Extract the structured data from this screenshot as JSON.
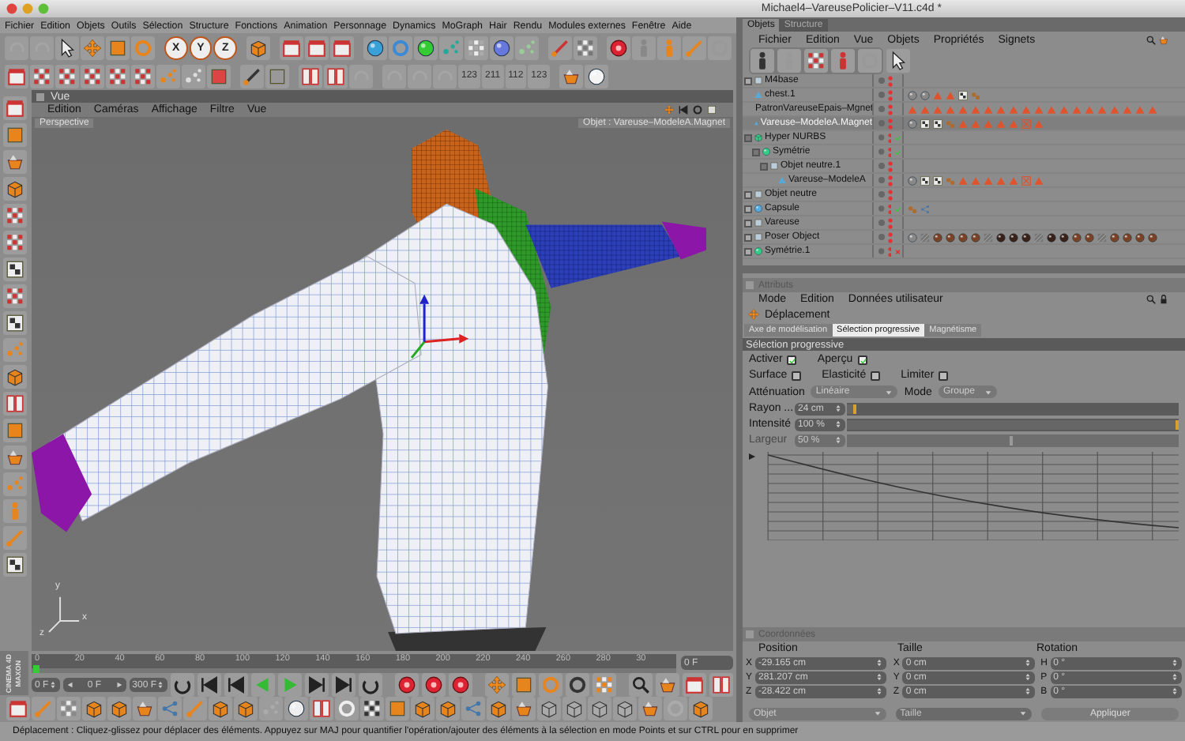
{
  "window": {
    "title": "Michael4–VareusePolicier–V11.c4d *"
  },
  "menu_bar": [
    "Fichier",
    "Edition",
    "Objets",
    "Outils",
    "Sélection",
    "Structure",
    "Fonctions",
    "Animation",
    "Personnage",
    "Dynamics",
    "MoGraph",
    "Hair",
    "Rendu",
    "Modules externes",
    "Fenêtre",
    "Aide"
  ],
  "toolbar": {
    "axis_buttons": [
      "X",
      "Y",
      "Z"
    ],
    "numbered_buttons": [
      "123",
      "211",
      "112",
      "123"
    ]
  },
  "viewport": {
    "title": "Vue",
    "menus": [
      "Edition",
      "Caméras",
      "Affichage",
      "Filtre",
      "Vue"
    ],
    "camera": "Perspective",
    "info": "Objet : Vareuse–ModeleA.Magnet",
    "axis_labels": [
      "y",
      "x",
      "z"
    ]
  },
  "logo": [
    "MAXON",
    "CINEMA 4D"
  ],
  "timeline": {
    "ticks": [
      "0",
      "20",
      "40",
      "60",
      "80",
      "100",
      "120",
      "140",
      "160",
      "180",
      "200",
      "220",
      "240",
      "260",
      "280",
      "30"
    ],
    "current_frame": "0 F"
  },
  "transport": {
    "start_field": "0 F",
    "range_label": "0 F",
    "end_field": "300 F"
  },
  "objects_panel": {
    "tabs": [
      {
        "label": "Objets",
        "selected": true
      },
      {
        "label": "Structure",
        "selected": false
      }
    ],
    "menus": [
      "Fichier",
      "Edition",
      "Vue",
      "Objets",
      "Propriétés",
      "Signets"
    ],
    "items": [
      {
        "name": "M4base",
        "kind": "null",
        "expanded": false,
        "selected": false
      },
      {
        "name": "chest.1",
        "kind": "polygon",
        "selected": false
      },
      {
        "name": "PatronVareuseEpais–Mgnet",
        "kind": "polygon",
        "selected": false
      },
      {
        "name": "Vareuse–ModeleA.Magnet",
        "kind": "polygon",
        "selected": true
      },
      {
        "name": "Hyper NURBS",
        "kind": "nurbs",
        "expanded": true,
        "selected": false,
        "enabled": true,
        "children": [
          {
            "name": "Symétrie",
            "kind": "symmetry",
            "expanded": true,
            "selected": false,
            "enabled": true,
            "children": [
              {
                "name": "Objet neutre.1",
                "kind": "null",
                "expanded": true,
                "selected": false,
                "children": [
                  {
                    "name": "Vareuse–ModeleA",
                    "kind": "polygon",
                    "selected": false
                  }
                ]
              }
            ]
          }
        ]
      },
      {
        "name": "Objet neutre",
        "kind": "null",
        "expanded": false,
        "selected": false
      },
      {
        "name": "Capsule",
        "kind": "capsule",
        "expanded": false,
        "selected": false,
        "enabled": true
      },
      {
        "name": "Vareuse",
        "kind": "null",
        "expanded": false,
        "selected": false
      },
      {
        "name": "Poser Object",
        "kind": "null",
        "expanded": false,
        "selected": false
      },
      {
        "name": "Symétrie.1",
        "kind": "symmetry",
        "expanded": false,
        "selected": false,
        "enabled": false
      }
    ]
  },
  "attributes": {
    "title": "Attributs",
    "menus": [
      "Mode",
      "Edition",
      "Données utilisateur"
    ],
    "tool": "Déplacement",
    "tabs": [
      {
        "label": "Axe de modélisation",
        "selected": false
      },
      {
        "label": "Sélection progressive",
        "selected": true
      },
      {
        "label": "Magnétisme",
        "selected": false
      }
    ],
    "section": "Sélection progressive",
    "checkbox_rows": [
      [
        {
          "label": "Activer",
          "checked": true
        },
        {
          "label": "Aperçu",
          "checked": true
        }
      ],
      [
        {
          "label": "Surface",
          "checked": false
        },
        {
          "label": "Elasticité",
          "checked": false
        },
        {
          "label": "Limiter",
          "checked": false
        }
      ]
    ],
    "dropdowns": [
      {
        "label": "Atténuation",
        "value": "Linéaire"
      },
      {
        "label": "Mode",
        "value": "Groupe"
      }
    ],
    "sliders": [
      {
        "label": "Rayon ...",
        "value": "24 cm",
        "level": 0.03,
        "disabled": false
      },
      {
        "label": "Intensité",
        "value": "100 %",
        "level": 1,
        "disabled": false
      },
      {
        "label": "Largeur",
        "value": "50 %",
        "level": 0.5,
        "disabled": true
      }
    ]
  },
  "coordinates": {
    "title": "Coordonnées",
    "columns": [
      {
        "heading": "Position",
        "axes": [
          "X",
          "Y",
          "Z"
        ],
        "values": [
          "-29.165 cm",
          "281.207 cm",
          "-28.422 cm"
        ]
      },
      {
        "heading": "Taille",
        "axes": [
          "X",
          "Y",
          "Z"
        ],
        "values": [
          "0 cm",
          "0 cm",
          "0 cm"
        ]
      },
      {
        "heading": "Rotation",
        "axes": [
          "H",
          "P",
          "B"
        ],
        "values": [
          "0 °",
          "0 °",
          "0 °"
        ]
      }
    ],
    "dropdowns": [
      {
        "value": "Objet",
        "disabled": false
      },
      {
        "value": "Taille",
        "disabled": true
      }
    ],
    "apply_button": "Appliquer"
  },
  "status_bar": "Déplacement : Cliquez-glissez pour déplacer des éléments. Appuyez sur MAJ pour quantifier l'opération/ajouter des éléments à la sélection en mode Points et sur CTRL pour en supprimer"
}
